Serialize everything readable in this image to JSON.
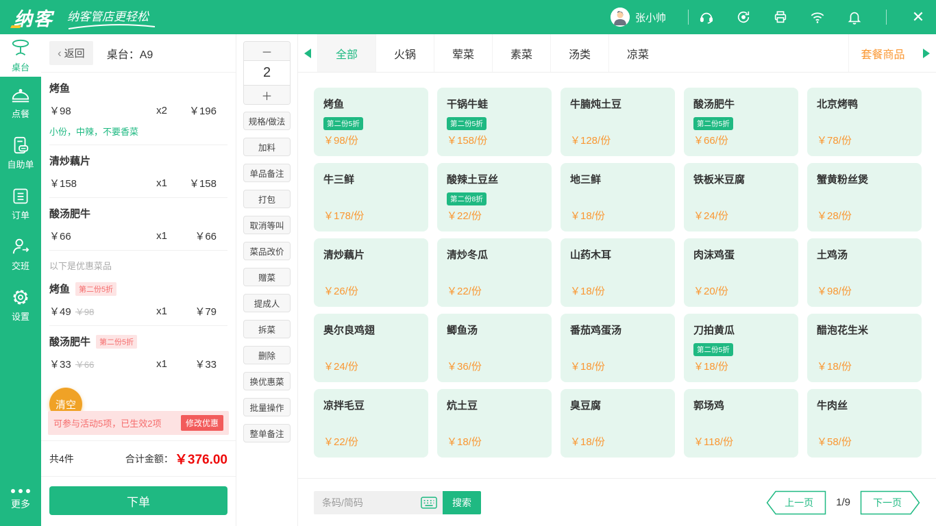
{
  "topbar": {
    "brand": "纳客",
    "slogan": "纳客管店更轻松",
    "user_name": "张小帅",
    "icons": [
      "headset-icon",
      "sync-icon",
      "printer-icon",
      "wifi-icon",
      "bell-icon",
      "close-icon"
    ]
  },
  "sidebar": {
    "items": [
      {
        "label": "桌台",
        "icon": "table-icon",
        "active": true
      },
      {
        "label": "点餐",
        "icon": "cloche-icon",
        "active": false
      },
      {
        "label": "自助单",
        "icon": "self-order-icon",
        "active": false
      },
      {
        "label": "订单",
        "icon": "clipboard-icon",
        "active": false
      },
      {
        "label": "交班",
        "icon": "shift-icon",
        "active": false
      },
      {
        "label": "设置",
        "icon": "gear-icon",
        "active": false
      }
    ],
    "more_label": "更多"
  },
  "order_panel": {
    "back_label": "返回",
    "table_label": "桌台：A9",
    "items": [
      {
        "name": "烤鱼",
        "price": "￥98",
        "qty": "x2",
        "total": "￥196",
        "note": "小份，中辣，不要香菜"
      },
      {
        "name": "清炒藕片",
        "price": "￥158",
        "qty": "x1",
        "total": "￥158",
        "note": ""
      },
      {
        "name": "酸汤肥牛",
        "price": "￥66",
        "qty": "x1",
        "total": "￥66",
        "note": ""
      }
    ],
    "discount_section_label": "以下是优惠菜品",
    "discount_items": [
      {
        "name": "烤鱼",
        "badge": "第二份5折",
        "price": "￥49",
        "orig": "￥98",
        "qty": "x1",
        "total": "￥79"
      },
      {
        "name": "酸汤肥牛",
        "badge": "第二份5折",
        "price": "￥33",
        "orig": "￥66",
        "qty": "x1",
        "total": "￥33"
      }
    ],
    "clear_label": "清空",
    "activity_text": "可参与活动5项，已生效2项",
    "modify_discount_label": "修改优惠",
    "count_label": "共4件",
    "total_label": "合计金额：",
    "total_value": "￥376.00",
    "submit_label": "下单"
  },
  "actions": {
    "minus": "－",
    "qty": "2",
    "plus": "＋",
    "buttons": [
      "规格/做法",
      "加料",
      "单品备注",
      "打包",
      "取消等叫",
      "菜品改价",
      "赠菜",
      "提成人",
      "拆菜",
      "删除",
      "换优惠菜",
      "批量操作",
      "整单备注"
    ]
  },
  "categories": {
    "tabs": [
      {
        "label": "全部",
        "active": true
      },
      {
        "label": "火锅",
        "active": false
      },
      {
        "label": "荤菜",
        "active": false
      },
      {
        "label": "素菜",
        "active": false
      },
      {
        "label": "汤类",
        "active": false
      },
      {
        "label": "凉菜",
        "active": false
      }
    ],
    "special_tab": "套餐商品"
  },
  "menu": {
    "items": [
      {
        "name": "烤鱼",
        "badge": "第二份5折",
        "price": "￥98/份"
      },
      {
        "name": "干锅牛蛙",
        "badge": "第二份5折",
        "price": "￥158/份"
      },
      {
        "name": "牛腩炖土豆",
        "badge": "",
        "price": "￥128/份"
      },
      {
        "name": "酸汤肥牛",
        "badge": "第二份5折",
        "price": "￥66/份"
      },
      {
        "name": "北京烤鸭",
        "badge": "",
        "price": "￥78/份"
      },
      {
        "name": "牛三鲜",
        "badge": "",
        "price": "￥178/份"
      },
      {
        "name": "酸辣土豆丝",
        "badge": "第二份8折",
        "price": "￥22/份"
      },
      {
        "name": "地三鲜",
        "badge": "",
        "price": "￥18/份"
      },
      {
        "name": "铁板米豆腐",
        "badge": "",
        "price": "￥24/份"
      },
      {
        "name": "蟹黄粉丝煲",
        "badge": "",
        "price": "￥28/份"
      },
      {
        "name": "清炒藕片",
        "badge": "",
        "price": "￥26/份"
      },
      {
        "name": "清炒冬瓜",
        "badge": "",
        "price": "￥22/份"
      },
      {
        "name": "山药木耳",
        "badge": "",
        "price": "￥18/份"
      },
      {
        "name": "肉沫鸡蛋",
        "badge": "",
        "price": "￥20/份"
      },
      {
        "name": "土鸡汤",
        "badge": "",
        "price": "￥98/份"
      },
      {
        "name": "奥尔良鸡翅",
        "badge": "",
        "price": "￥24/份"
      },
      {
        "name": "鲫鱼汤",
        "badge": "",
        "price": "￥36/份"
      },
      {
        "name": "番茄鸡蛋汤",
        "badge": "",
        "price": "￥18/份"
      },
      {
        "name": "刀拍黄瓜",
        "badge": "第二份5折",
        "price": "￥18/份"
      },
      {
        "name": "醋泡花生米",
        "badge": "",
        "price": "￥18/份"
      },
      {
        "name": "凉拌毛豆",
        "badge": "",
        "price": "￥22/份"
      },
      {
        "name": "炕土豆",
        "badge": "",
        "price": "￥18/份"
      },
      {
        "name": "臭豆腐",
        "badge": "",
        "price": "￥18/份"
      },
      {
        "name": "郭场鸡",
        "badge": "",
        "price": "￥118/份"
      },
      {
        "name": "牛肉丝",
        "badge": "",
        "price": "￥58/份"
      }
    ]
  },
  "bottombar": {
    "search_placeholder": "条码/简码",
    "search_label": "搜索",
    "prev_label": "上一页",
    "page_indicator": "1/9",
    "next_label": "下一页"
  },
  "colors": {
    "primary_green": "#1FB982",
    "price_orange": "#FA9732",
    "danger_red": "#F56C6C",
    "total_red": "#EE0A0A",
    "clear_orange": "#F0A226",
    "card_mint": "#E5F6EE"
  }
}
